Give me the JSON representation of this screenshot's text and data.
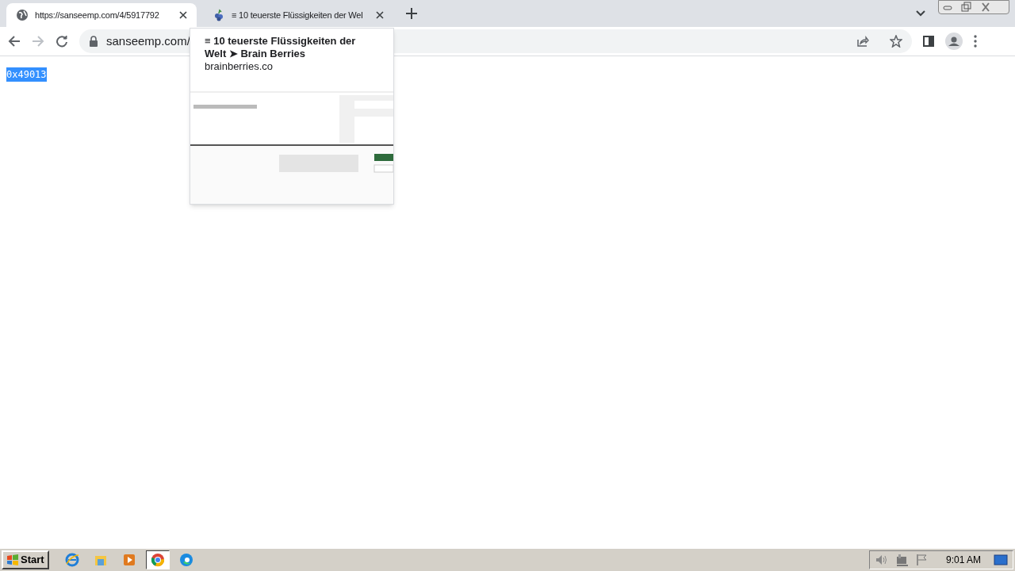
{
  "tabs": [
    {
      "title": "https://sanseemp.com/4/5917792",
      "selected": true
    },
    {
      "title": "≡ 10 teuerste Flüssigkeiten der Wel",
      "selected": false
    }
  ],
  "address_bar": {
    "url": "sanseemp.com/"
  },
  "hover_card": {
    "title": "≡ 10 teuerste Flüssigkeiten der Welt ➤ Brain Berries",
    "domain": "brainberries.co"
  },
  "page": {
    "text": "0x49013",
    "selected": true
  },
  "taskbar": {
    "start": "Start",
    "apps": [
      {
        "selected": false
      },
      {
        "selected": false
      },
      {
        "selected": false
      },
      {
        "selected": true
      },
      {
        "selected": false
      }
    ],
    "clock": "9:01 AM"
  }
}
